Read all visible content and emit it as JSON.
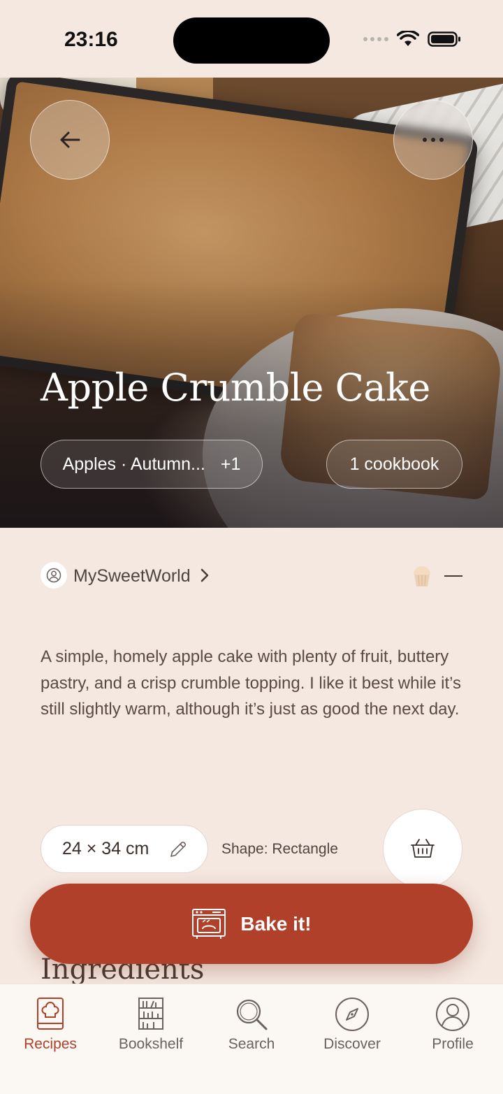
{
  "status_bar": {
    "time": "23:16"
  },
  "recipe": {
    "title": "Apple Crumble Cake",
    "tags_chip": "Apples · Autumn...",
    "tags_extra": "+1",
    "cookbook_chip": "1 cookbook",
    "author": "MySweetWorld",
    "description": "A simple, homely apple cake with plenty of fruit, buttery pastry, and a crisp crumble topping. I like it best while it’s still slightly warm, although it’s just as good the next day.",
    "size": "24 × 34 cm",
    "shape": "Shape: Rectangle",
    "section_heading": "Ingredients",
    "bake_label": "Bake it!"
  },
  "tabs": [
    {
      "label": "Recipes",
      "icon": "chef-book-icon",
      "active": true
    },
    {
      "label": "Bookshelf",
      "icon": "bookshelf-icon",
      "active": false
    },
    {
      "label": "Search",
      "icon": "search-icon",
      "active": false
    },
    {
      "label": "Discover",
      "icon": "compass-icon",
      "active": false
    },
    {
      "label": "Profile",
      "icon": "profile-icon",
      "active": false
    }
  ],
  "colors": {
    "accent": "#b0402a",
    "background": "#f4e8e0",
    "text": "#4a3a33"
  }
}
